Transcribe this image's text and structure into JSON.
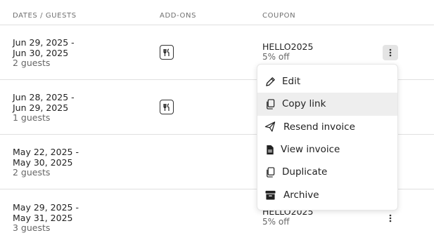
{
  "header": {
    "dates_guests": "DATES / GUESTS",
    "add_ons": "ADD-ONS",
    "coupon": "COUPON"
  },
  "rows": [
    {
      "date_start": "Jun 29, 2025 -",
      "date_end": "Jun 30, 2025",
      "guests": "2 guests",
      "addon_icon": "fork-knife-icon",
      "coupon_code": "HELLO2025",
      "coupon_discount": "5% off"
    },
    {
      "date_start": "Jun 28, 2025 -",
      "date_end": "Jun 29, 2025",
      "guests": "1 guests",
      "addon_icon": "fork-knife-icon"
    },
    {
      "date_start": "May 22, 2025 -",
      "date_end": "May 30, 2025",
      "guests": "2 guests"
    },
    {
      "date_start": "May 29, 2025 -",
      "date_end": "May 31, 2025",
      "guests": "3 guests",
      "coupon_code": "HELLO2025",
      "coupon_discount": "5% off"
    }
  ],
  "menu": {
    "items": [
      {
        "label": "Edit",
        "icon": "pencil-icon"
      },
      {
        "label": "Copy link",
        "icon": "copy-icon",
        "hovered": true
      },
      {
        "label": "Resend invoice",
        "icon": "send-icon"
      },
      {
        "label": "View invoice",
        "icon": "document-icon"
      },
      {
        "label": "Duplicate",
        "icon": "copy-icon"
      },
      {
        "label": "Archive",
        "icon": "archive-icon"
      }
    ]
  },
  "colors": {
    "border": "#e0e0e0",
    "header_text": "#6f6f6f",
    "hover_bg": "#eeeeee",
    "active_kebab_bg": "#e4e4e4"
  }
}
